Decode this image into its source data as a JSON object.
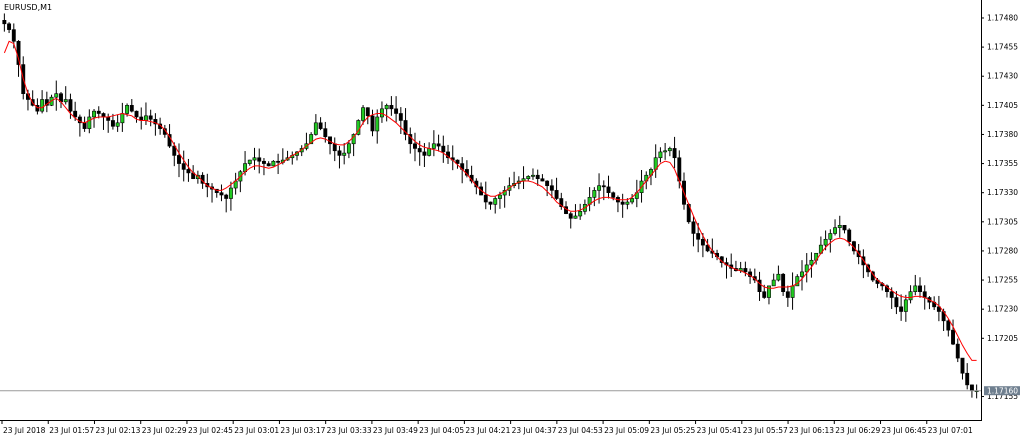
{
  "window": {
    "symbol_title": "EURUSD,M1"
  },
  "colors": {
    "background": "#ffffff",
    "axis": "#000000",
    "bull_candle": "#22c922",
    "bear_candle": "#000000",
    "ma_line": "#ff0000",
    "bid_line": "#9a9a9a",
    "price_badge_bg": "#6f7f8f",
    "price_badge_text": "#ffffff"
  },
  "chart_data": {
    "type": "candlestick",
    "symbol": "EURUSD",
    "timeframe": "M1",
    "y_ticks": [
      "1.17480",
      "1.17455",
      "1.17430",
      "1.17405",
      "1.17380",
      "1.17355",
      "1.17330",
      "1.17305",
      "1.17280",
      "1.17255",
      "1.17230",
      "1.17205",
      "1.17155"
    ],
    "ylim": [
      1.1714,
      1.17492
    ],
    "x_ticks": [
      "23 Jul 2018",
      "23 Jul 01:57",
      "23 Jul 02:13",
      "23 Jul 02:29",
      "23 Jul 02:45",
      "23 Jul 03:01",
      "23 Jul 03:17",
      "23 Jul 03:33",
      "23 Jul 03:49",
      "23 Jul 04:05",
      "23 Jul 04:21",
      "23 Jul 04:37",
      "23 Jul 04:53",
      "23 Jul 05:09",
      "23 Jul 05:25",
      "23 Jul 05:41",
      "23 Jul 05:57",
      "23 Jul 06:13",
      "23 Jul 06:29",
      "23 Jul 06:45",
      "23 Jul 07:01"
    ],
    "current_price": "1.17160",
    "current_price_value": 1.1716,
    "close_path": [
      1.17475,
      1.1747,
      1.1746,
      1.1744,
      1.17415,
      1.1741,
      1.17405,
      1.174,
      1.1741,
      1.17405,
      1.17412,
      1.17415,
      1.17408,
      1.1741,
      1.174,
      1.17395,
      1.1739,
      1.17385,
      1.17395,
      1.174,
      1.17398,
      1.17395,
      1.17392,
      1.17387,
      1.1739,
      1.17398,
      1.17405,
      1.174,
      1.17395,
      1.17392,
      1.17396,
      1.17393,
      1.17389,
      1.17385,
      1.1738,
      1.1737,
      1.17362,
      1.17355,
      1.1735,
      1.17347,
      1.17342,
      1.17345,
      1.17338,
      1.17335,
      1.17333,
      1.1733,
      1.17328,
      1.17325,
      1.17334,
      1.1734,
      1.17348,
      1.17355,
      1.17358,
      1.1736,
      1.17357,
      1.17355,
      1.17353,
      1.17357,
      1.17356,
      1.17358,
      1.1736,
      1.17362,
      1.17365,
      1.17368,
      1.17372,
      1.1738,
      1.1739,
      1.17385,
      1.17378,
      1.17372,
      1.17366,
      1.17362,
      1.17364,
      1.17372,
      1.1738,
      1.17392,
      1.17403,
      1.17396,
      1.17383,
      1.17395,
      1.17402,
      1.17405,
      1.17402,
      1.17398,
      1.17392,
      1.1738,
      1.17372,
      1.17368,
      1.17365,
      1.17362,
      1.17368,
      1.17372,
      1.1737,
      1.17365,
      1.1736,
      1.17358,
      1.17355,
      1.1735,
      1.17345,
      1.1734,
      1.17335,
      1.17328,
      1.17322,
      1.1732,
      1.17325,
      1.17328,
      1.17332,
      1.17336,
      1.17338,
      1.1734,
      1.17342,
      1.17344,
      1.17345,
      1.17342,
      1.1734,
      1.17336,
      1.17332,
      1.17325,
      1.17318,
      1.17312,
      1.17308,
      1.1731,
      1.17314,
      1.1732,
      1.17326,
      1.17332,
      1.17336,
      1.17335,
      1.1733,
      1.17326,
      1.17322,
      1.1732,
      1.17322,
      1.17325,
      1.1733,
      1.1734,
      1.17345,
      1.1735,
      1.1736,
      1.17365,
      1.17366,
      1.17368,
      1.1736,
      1.1734,
      1.1732,
      1.17305,
      1.17295,
      1.1729,
      1.17285,
      1.1728,
      1.17278,
      1.17275,
      1.1727,
      1.17268,
      1.17265,
      1.17263,
      1.17265,
      1.17262,
      1.17258,
      1.17255,
      1.17245,
      1.1724,
      1.1725,
      1.17255,
      1.1726,
      1.17245,
      1.1724,
      1.1725,
      1.17258,
      1.17262,
      1.17268,
      1.17272,
      1.17278,
      1.17285,
      1.1729,
      1.17295,
      1.173,
      1.17302,
      1.17298,
      1.17288,
      1.1728,
      1.17275,
      1.17268,
      1.17262,
      1.17255,
      1.17252,
      1.1725,
      1.17245,
      1.1724,
      1.17232,
      1.17228,
      1.17238,
      1.17245,
      1.1725,
      1.17245,
      1.1724,
      1.17236,
      1.17232,
      1.17228,
      1.1722,
      1.17212,
      1.172,
      1.17188,
      1.17175,
      1.17165,
      1.1716,
      1.1716
    ],
    "ma_path": [
      1.1745,
      1.1746,
      1.17458,
      1.17445,
      1.17428,
      1.17415,
      1.17407,
      1.17403,
      1.17403,
      1.17406,
      1.17409,
      1.17411,
      1.17408,
      1.17403,
      1.17398,
      1.17394,
      1.17391,
      1.1739,
      1.17392,
      1.17394,
      1.17395,
      1.17395,
      1.17395,
      1.17396,
      1.17397,
      1.17398,
      1.17397,
      1.17396,
      1.17393,
      1.17392,
      1.17392,
      1.17391,
      1.1739,
      1.17388,
      1.17384,
      1.17378,
      1.17371,
      1.17364,
      1.17358,
      1.17352,
      1.17347,
      1.17344,
      1.1734,
      1.17336,
      1.17334,
      1.17332,
      1.17332,
      1.17334,
      1.17337,
      1.1734,
      1.17344,
      1.17348,
      1.17351,
      1.17353,
      1.17353,
      1.17352,
      1.17351,
      1.17352,
      1.17354,
      1.17356,
      1.17359,
      1.17362,
      1.17364,
      1.17367,
      1.1737,
      1.17373,
      1.17376,
      1.17377,
      1.17376,
      1.17374,
      1.17372,
      1.17371,
      1.17371,
      1.17374,
      1.17378,
      1.17383,
      1.1739,
      1.17395,
      1.17397,
      1.17398,
      1.17398,
      1.17396,
      1.17393,
      1.1739,
      1.17386,
      1.17382,
      1.17378,
      1.17374,
      1.17371,
      1.17369,
      1.17368,
      1.17367,
      1.17366,
      1.17364,
      1.17361,
      1.17358,
      1.17354,
      1.1735,
      1.17346,
      1.17341,
      1.17336,
      1.17332,
      1.17329,
      1.17327,
      1.17327,
      1.17329,
      1.17331,
      1.17334,
      1.17337,
      1.17339,
      1.1734,
      1.1734,
      1.17339,
      1.17337,
      1.17335,
      1.17331,
      1.17327,
      1.17322,
      1.17319,
      1.17316,
      1.17314,
      1.17314,
      1.17315,
      1.17317,
      1.1732,
      1.17323,
      1.17325,
      1.17326,
      1.17326,
      1.17325,
      1.17324,
      1.17324,
      1.17324,
      1.17326,
      1.1733,
      1.17335,
      1.1734,
      1.17345,
      1.1735,
      1.17355,
      1.17357,
      1.17356,
      1.1735,
      1.1734,
      1.1733,
      1.1732,
      1.1731,
      1.17301,
      1.17293,
      1.17286,
      1.1728,
      1.17275,
      1.17271,
      1.17268,
      1.17266,
      1.17264,
      1.17263,
      1.17261,
      1.17259,
      1.17256,
      1.17252,
      1.17249,
      1.17248,
      1.17248,
      1.17249,
      1.17249,
      1.17249,
      1.1725,
      1.17252,
      1.17256,
      1.17261,
      1.17266,
      1.17272,
      1.17278,
      1.17283,
      1.17287,
      1.1729,
      1.17291,
      1.1729,
      1.17287,
      1.17283,
      1.17278,
      1.17272,
      1.17266,
      1.1726,
      1.17255,
      1.17252,
      1.17249,
      1.17246,
      1.17243,
      1.17241,
      1.1724,
      1.1724,
      1.17241,
      1.17241,
      1.1724,
      1.17238,
      1.17236,
      1.17233,
      1.17228,
      1.17222,
      1.17215,
      1.17207,
      1.17199,
      1.17192,
      1.17186,
      1.17186
    ]
  }
}
